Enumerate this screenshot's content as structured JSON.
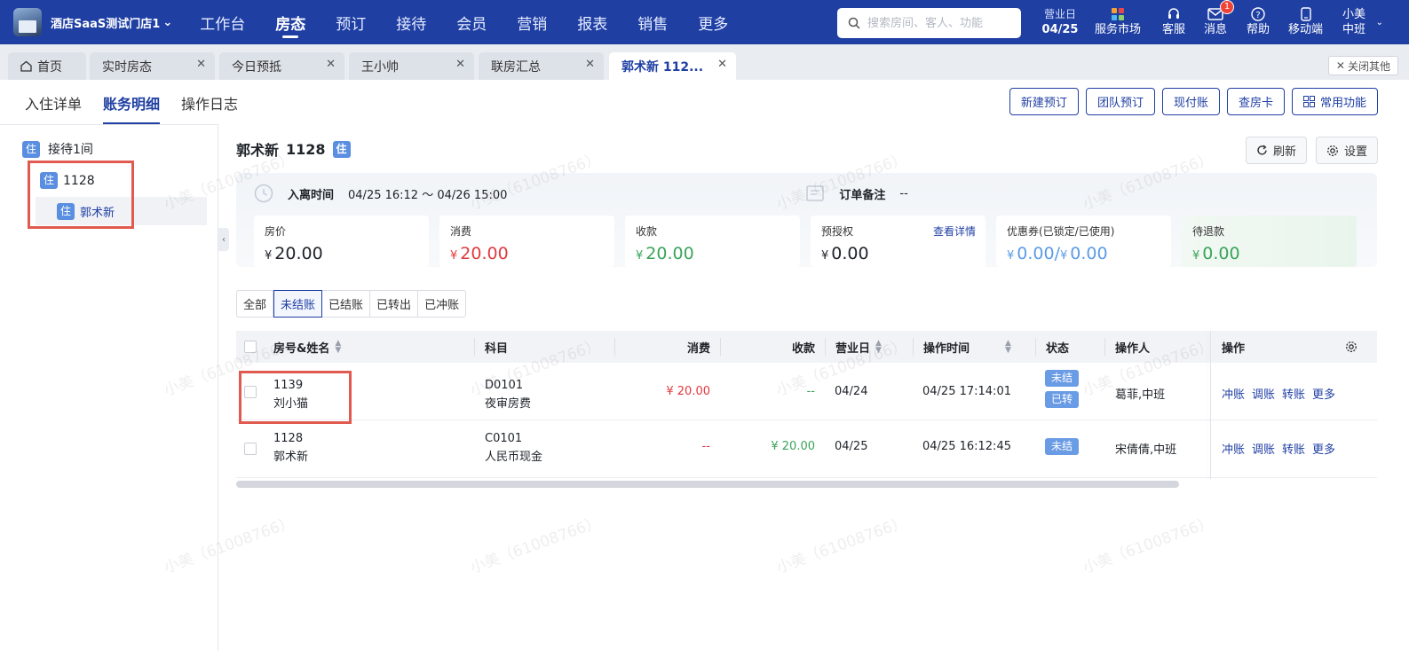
{
  "topbar": {
    "store_name": "酒店SaaS测试门店1",
    "nav": [
      "工作台",
      "房态",
      "预订",
      "接待",
      "会员",
      "营销",
      "报表",
      "销售",
      "更多"
    ],
    "active_nav": "房态",
    "search_placeholder": "搜索房间、客人、功能",
    "business_day_label": "营业日",
    "business_day": "04/25",
    "tools": {
      "market": "服务市场",
      "service": "客服",
      "message": "消息",
      "message_count": "1",
      "help": "帮助",
      "mobile": "移动端"
    },
    "user_name": "小美",
    "user_shift": "中班"
  },
  "tabs": [
    {
      "label": "首页"
    },
    {
      "label": "实时房态"
    },
    {
      "label": "今日预抵"
    },
    {
      "label": "王小帅"
    },
    {
      "label": "联房汇总"
    },
    {
      "label": "郭术新 112..."
    }
  ],
  "close_others": "关闭其他",
  "subtabs": [
    "入住详单",
    "账务明细",
    "操作日志"
  ],
  "top_buttons": [
    "新建预订",
    "团队预订",
    "现付账",
    "查房卡",
    "常用功能"
  ],
  "tree": {
    "group": "接待1间",
    "room": "1128",
    "guest": "郭术新",
    "tag": "住"
  },
  "header": {
    "guest": "郭术新",
    "room": "1128",
    "tag": "住",
    "refresh": "刷新",
    "settings": "设置"
  },
  "info": {
    "stay_label": "入离时间",
    "stay_value": "04/25 16:12 ～ 04/26 15:00",
    "remark_label": "订单备注",
    "remark_value": "--"
  },
  "cards": [
    {
      "label": "房价",
      "currency": "¥",
      "value": "20.00",
      "color": "#1f2329"
    },
    {
      "label": "消费",
      "currency": "¥",
      "value": "20.00",
      "color": "#e0393e"
    },
    {
      "label": "收款",
      "currency": "¥",
      "value": "20.00",
      "color": "#3aa35a"
    },
    {
      "label": "预授权",
      "currency": "¥",
      "value": "0.00",
      "color": "#1f2329",
      "link": "查看详情"
    },
    {
      "label": "优惠券(已锁定/已使用)",
      "currency": "¥",
      "value": "0.00",
      "currency2": "¥",
      "value2": "0.00",
      "color": "#5b9be6"
    },
    {
      "label": "待退款",
      "currency": "¥",
      "value": "0.00",
      "color": "#3aa35a"
    }
  ],
  "filters": [
    "全部",
    "未结账",
    "已结账",
    "已转出",
    "已冲账"
  ],
  "active_filter": "未结账",
  "table": {
    "columns": [
      "房号&姓名",
      "科目",
      "消费",
      "收款",
      "营业日",
      "操作时间",
      "状态",
      "操作人",
      "操作"
    ],
    "rows": [
      {
        "room": "1139",
        "name": "刘小猫",
        "code": "D0101",
        "item": "夜审房费",
        "consume": "¥ 20.00",
        "receive": "--",
        "bizday": "04/24",
        "optime": "04/25 17:14:01",
        "status": [
          "未结",
          "已转"
        ],
        "operator": "葛菲,中班",
        "ops": [
          "冲账",
          "调账",
          "转账",
          "更多"
        ]
      },
      {
        "room": "1128",
        "name": "郭术新",
        "code": "C0101",
        "item": "人民币现金",
        "consume": "--",
        "receive": "¥ 20.00",
        "bizday": "04/25",
        "optime": "04/25 16:12:45",
        "status": [
          "未结"
        ],
        "operator": "宋倩倩,中班",
        "ops": [
          "冲账",
          "调账",
          "转账",
          "更多"
        ]
      }
    ]
  },
  "watermark": "小美（61008766）"
}
